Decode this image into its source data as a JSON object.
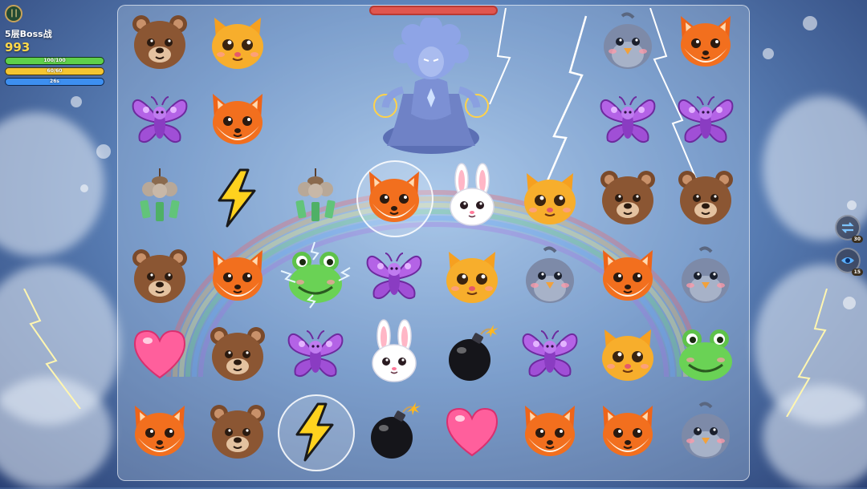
{
  "hud": {
    "pause_icon": "pause-icon",
    "level_title": "5层Boss战",
    "score": "993",
    "health": {
      "label": "100/100",
      "fraction": 1.0,
      "color": "#5fd04a"
    },
    "energy": {
      "label": "60/60",
      "fraction": 1.0,
      "color": "#f4c531"
    },
    "timer": {
      "label": "26s",
      "fraction": 1.0,
      "color": "#3d8ff0"
    }
  },
  "boss": {
    "name_icon": "storm-goddess-boss",
    "health_fraction": 1.0,
    "health_color": "#e0564f"
  },
  "board": {
    "rows": [
      [
        "bear",
        "cat",
        null,
        null,
        null,
        null,
        "bird",
        "fox"
      ],
      [
        "butterfly",
        "fox",
        null,
        null,
        null,
        null,
        "butterfly",
        "butterfly"
      ],
      [
        "windchime",
        "lightning",
        "windchime",
        "fox",
        "rabbit",
        "cat",
        "bear",
        "bear"
      ],
      [
        "bear",
        "fox",
        "frog",
        "butterfly",
        "cat",
        "bird",
        "fox",
        "bird"
      ],
      [
        "heart",
        "bear",
        "butterfly",
        "rabbit",
        "bomb",
        "butterfly",
        "cat",
        "frog"
      ],
      [
        "fox",
        "bear",
        "lightning",
        "bomb",
        "heart",
        "fox",
        "fox",
        "bird"
      ]
    ],
    "highlighted": [
      [
        2,
        3
      ],
      [
        5,
        2
      ]
    ],
    "electrified": [
      [
        3,
        2
      ]
    ]
  },
  "powerups": [
    {
      "icon": "shuffle-icon",
      "count": "30"
    },
    {
      "icon": "eye-icon",
      "count": "15"
    }
  ]
}
